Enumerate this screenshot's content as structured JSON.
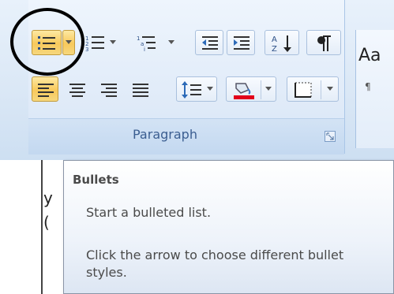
{
  "ribbon": {
    "group_label": "Paragraph",
    "styles_sample": "Aa",
    "styles_sub": "¶"
  },
  "document": {
    "fragments": [
      "y",
      "("
    ]
  },
  "tooltip": {
    "title": "Bullets",
    "description": "Start a bulleted list.",
    "help": "Click the arrow to choose different bullet styles."
  },
  "colors": {
    "active_button": "#f8c95c",
    "ribbon_bg": "#dbe8f6",
    "label_text": "#3b5e91",
    "highlight_circle": "#000000",
    "shading_color": "#e2001a"
  },
  "icons": {
    "bullets": "bullets-icon",
    "numbering": "numbering-icon",
    "multilevel": "multilevel-list-icon",
    "decrease_indent": "decrease-indent-icon",
    "increase_indent": "increase-indent-icon",
    "sort": "sort-icon",
    "pilcrow": "show-formatting-marks-icon",
    "align_left": "align-left-icon",
    "center": "center-icon",
    "align_right": "align-right-icon",
    "justify": "justify-icon",
    "line_spacing": "line-spacing-icon",
    "shading": "shading-bucket-icon",
    "borders": "borders-icon",
    "dialog_launcher": "dialog-launcher-icon"
  }
}
